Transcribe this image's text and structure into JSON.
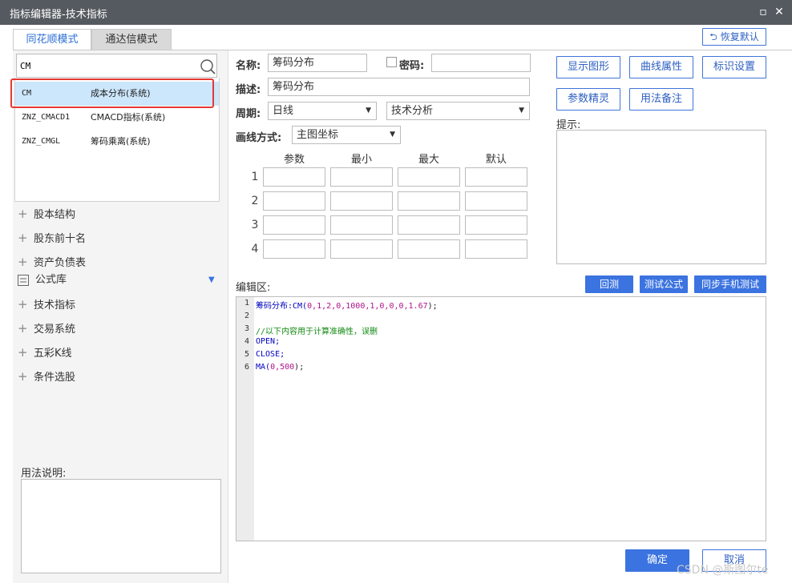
{
  "window": {
    "title": "指标编辑器-技术指标",
    "restore_glyph": "▫",
    "close_glyph": "✕"
  },
  "tabs": [
    {
      "label": "同花顺模式",
      "active": true
    },
    {
      "label": "通达信模式",
      "active": false
    }
  ],
  "restore_default": {
    "label": "恢复默认",
    "icon": "undo-icon"
  },
  "search": {
    "value": "CM",
    "icon": "search-icon"
  },
  "results": [
    {
      "code": "CM",
      "desc": "成本分布(系统)",
      "selected": true
    },
    {
      "code": "ZNZ_CMACD1",
      "desc": "CMACD指标(系统)",
      "selected": false
    },
    {
      "code": "ZNZ_CMGL",
      "desc": "筹码乘离(系统)",
      "selected": false
    }
  ],
  "tree": [
    {
      "label": "股本结构",
      "icon": "plus-icon"
    },
    {
      "label": "股东前十名",
      "icon": "plus-icon"
    },
    {
      "label": "资产负债表",
      "icon": "plus-icon"
    },
    {
      "label": "公式库",
      "icon": "list-icon"
    },
    {
      "label": "技术指标",
      "icon": "plus-icon"
    },
    {
      "label": "交易系统",
      "icon": "plus-icon"
    },
    {
      "label": "五彩K线",
      "icon": "plus-icon"
    },
    {
      "label": "条件选股",
      "icon": "plus-icon"
    }
  ],
  "usage_label": "用法说明:",
  "form": {
    "name_label": "名称:",
    "name_value": "筹码分布",
    "password_label": "密码:",
    "password_value": "",
    "desc_label": "描述:",
    "desc_value": "筹码分布",
    "period_label": "周期:",
    "period_value": "日线",
    "category_value": "技术分析",
    "draw_label": "画线方式:",
    "draw_value": "主图坐标"
  },
  "params": {
    "headers": [
      "参数",
      "最小",
      "最大",
      "默认"
    ],
    "rows": [
      "1",
      "2",
      "3",
      "4"
    ]
  },
  "right_buttons": [
    "显示图形",
    "曲线属性",
    "标识设置",
    "参数精灵",
    "用法备注"
  ],
  "hint_label": "提示:",
  "editor": {
    "label": "编辑区:",
    "buttons": [
      "回测",
      "测试公式",
      "同步手机测试"
    ],
    "line_numbers": [
      "1",
      "2",
      "3",
      "4",
      "5",
      "6"
    ],
    "line1_name": "筹码分布",
    "line1_fn": ":CM(",
    "line1_args": "0,1,2,0,1000,1,0,0,0,1.67",
    "line1_end": ");",
    "line3_comment": "//以下内容用于计算准确性，误删",
    "line4": "OPEN;",
    "line5": "CLOSE;",
    "line6_fn": "MA(",
    "line6_args": "0,500",
    "line6_end": ");"
  },
  "footer": {
    "ok": "确定",
    "cancel": "取消"
  },
  "watermark": "CSDN @斯图尔te",
  "colors": {
    "accent": "#3b73e0",
    "title_bar": "#555a60",
    "selected_row": "#cce6fb",
    "highlight_box": "#e53935"
  }
}
